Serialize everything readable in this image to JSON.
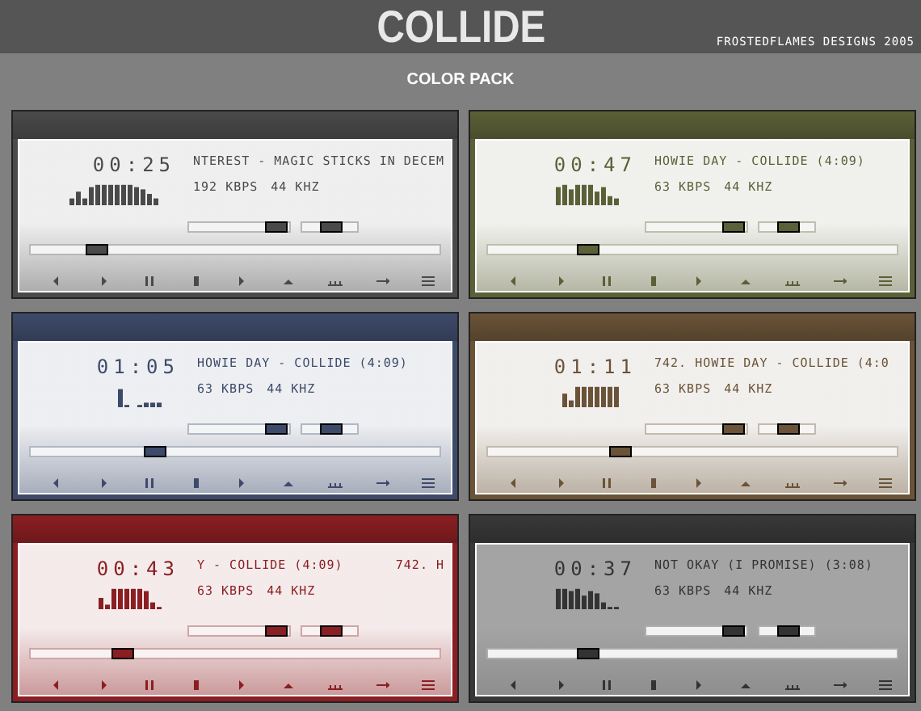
{
  "header": {
    "title": "COLLIDE",
    "credit": "FROSTEDFLAMES DESIGNS 2005"
  },
  "subtitle": "COLOR PACK",
  "players": [
    {
      "color": "#4a4a4a",
      "kind": "light",
      "time": "00:25",
      "track": "NTEREST - MAGIC STICKS IN DECEM",
      "bitrate": "192 KBPS",
      "samplerate": "44 KHZ",
      "volume": {
        "level": 0.85
      },
      "balance": {
        "level": 0.5
      },
      "seek": {
        "level": 0.16
      }
    },
    {
      "color": "#5c6038",
      "kind": "light",
      "time": "00:47",
      "track": "HOWIE DAY - COLLIDE (4:09)",
      "bitrate": "63 KBPS",
      "samplerate": "44 KHZ",
      "volume": {
        "level": 0.85
      },
      "balance": {
        "level": 0.5
      },
      "seek": {
        "level": 0.24
      }
    },
    {
      "color": "#3d4a6a",
      "kind": "light",
      "time": "01:05",
      "track": "HOWIE DAY - COLLIDE (4:09)",
      "bitrate": "63 KBPS",
      "samplerate": "44 KHZ",
      "volume": {
        "level": 0.85
      },
      "balance": {
        "level": 0.5
      },
      "seek": {
        "level": 0.3
      }
    },
    {
      "color": "#6a5338",
      "kind": "light",
      "time": "01:11",
      "track": "742. HOWIE DAY - COLLIDE (4:0",
      "bitrate": "63 KBPS",
      "samplerate": "44 KHZ",
      "volume": {
        "level": 0.85
      },
      "balance": {
        "level": 0.5
      },
      "seek": {
        "level": 0.32
      }
    },
    {
      "color": "#8a1e22",
      "kind": "light",
      "time": "00:43",
      "track": "Y - COLLIDE (4:09)",
      "track_tail": "742. H",
      "bitrate": "63 KBPS",
      "samplerate": "44 KHZ",
      "volume": {
        "level": 0.85
      },
      "balance": {
        "level": 0.5
      },
      "seek": {
        "level": 0.22
      }
    },
    {
      "color": "#383838",
      "kind": "dark",
      "time": "00:37",
      "track": "NOT OKAY (I PROMISE) (3:08)",
      "bitrate": "63 KBPS",
      "samplerate": "44 KHZ",
      "volume": {
        "level": 0.85
      },
      "balance": {
        "level": 0.5
      },
      "seek": {
        "level": 0.24
      }
    }
  ]
}
